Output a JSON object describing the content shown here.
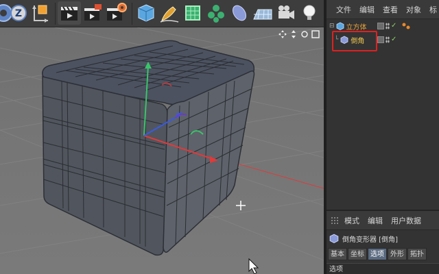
{
  "toolbar": {
    "buttons": [
      {
        "name": "rotate-mode-icon"
      },
      {
        "name": "axis-z-lock-icon",
        "label": "Z"
      },
      {
        "name": "coordinate-system-icon"
      },
      {
        "name": "render-view-icon"
      },
      {
        "name": "render-picture-viewer-icon"
      },
      {
        "name": "render-settings-icon"
      },
      {
        "name": "cube-primitive-icon"
      },
      {
        "name": "pen-spline-icon"
      },
      {
        "name": "subdivision-surface-icon"
      },
      {
        "name": "cloner-icon"
      },
      {
        "name": "deformer-icon"
      },
      {
        "name": "floor-scene-icon"
      },
      {
        "name": "camera-icon"
      },
      {
        "name": "light-icon"
      }
    ]
  },
  "object_manager": {
    "menu": [
      "文件",
      "编辑",
      "查看",
      "对象",
      "标"
    ],
    "objects": [
      {
        "label": "立方体",
        "color": "#e8a23a",
        "icon": "cube-object-icon",
        "check": "✓"
      },
      {
        "label": "倒角",
        "color": "#f0c850",
        "icon": "bevel-deformer-icon",
        "check": "✓"
      }
    ]
  },
  "attribute_manager": {
    "menu": [
      "模式",
      "编辑",
      "用户数据"
    ],
    "title": "倒角变形器 [倒角]",
    "tabs": [
      {
        "label": "基本",
        "active": false
      },
      {
        "label": "坐标",
        "active": false
      },
      {
        "label": "选项",
        "active": true
      },
      {
        "label": "外形",
        "active": false
      },
      {
        "label": "拓扑",
        "active": false
      }
    ],
    "section": "选项"
  },
  "colors": {
    "highlight": "#e02020",
    "axis_x": "#e03a3a",
    "axis_y": "#3ac46a",
    "axis_z": "#3a5ae0",
    "active_tab": "#5a6a80"
  }
}
